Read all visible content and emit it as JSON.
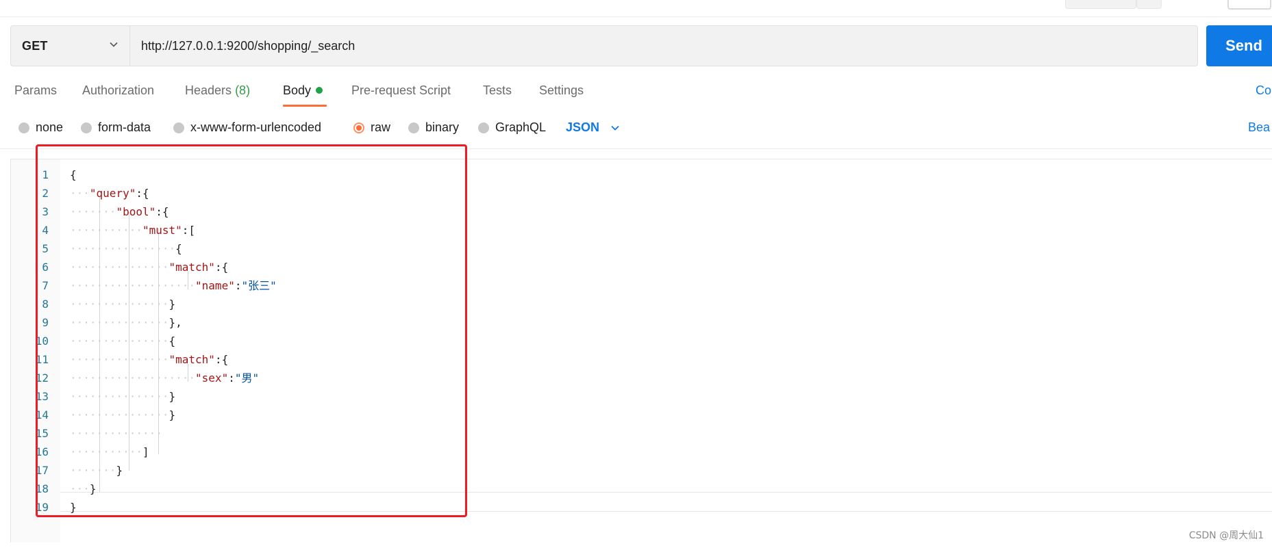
{
  "request": {
    "method": "GET",
    "url": "http://127.0.0.1:9200/shopping/_search",
    "send_label": "Send"
  },
  "tabs": [
    {
      "label": "Params"
    },
    {
      "label": "Authorization"
    },
    {
      "label": "Headers",
      "count": "(8)"
    },
    {
      "label": "Body"
    },
    {
      "label": "Pre-request Script"
    },
    {
      "label": "Tests"
    },
    {
      "label": "Settings"
    }
  ],
  "tabs_right_link": "Co",
  "body_types": [
    {
      "label": "none"
    },
    {
      "label": "form-data"
    },
    {
      "label": "x-www-form-urlencoded"
    },
    {
      "label": "raw"
    },
    {
      "label": "binary"
    },
    {
      "label": "GraphQL"
    }
  ],
  "selected_body_type": "raw",
  "language": "JSON",
  "beautify_label": "Bea",
  "editor": {
    "lines": [
      {
        "n": "1",
        "indent": "",
        "code": [
          {
            "t": "{",
            "c": "p"
          }
        ]
      },
      {
        "n": "2",
        "indent": "···",
        "code": [
          {
            "t": "\"query\"",
            "c": "k"
          },
          {
            "t": ":{",
            "c": "p"
          }
        ]
      },
      {
        "n": "3",
        "indent": "·······",
        "code": [
          {
            "t": "\"bool\"",
            "c": "k"
          },
          {
            "t": ":{",
            "c": "p"
          }
        ]
      },
      {
        "n": "4",
        "indent": "···········",
        "code": [
          {
            "t": "\"must\"",
            "c": "k"
          },
          {
            "t": ":[",
            "c": "p"
          }
        ]
      },
      {
        "n": "5",
        "indent": "················",
        "code": [
          {
            "t": "{",
            "c": "p"
          }
        ]
      },
      {
        "n": "6",
        "indent": "···············",
        "code": [
          {
            "t": "\"match\"",
            "c": "k"
          },
          {
            "t": ":{",
            "c": "p"
          }
        ]
      },
      {
        "n": "7",
        "indent": "···················",
        "code": [
          {
            "t": "\"name\"",
            "c": "k"
          },
          {
            "t": ":",
            "c": "p"
          },
          {
            "t": "\"张三\"",
            "c": "s"
          }
        ]
      },
      {
        "n": "8",
        "indent": "···············",
        "code": [
          {
            "t": "}",
            "c": "p"
          }
        ]
      },
      {
        "n": "9",
        "indent": "···············",
        "code": [
          {
            "t": "},",
            "c": "p"
          }
        ]
      },
      {
        "n": "10",
        "indent": "···············",
        "code": [
          {
            "t": "{",
            "c": "p"
          }
        ]
      },
      {
        "n": "11",
        "indent": "···············",
        "code": [
          {
            "t": "\"match\"",
            "c": "k"
          },
          {
            "t": ":{",
            "c": "p"
          }
        ]
      },
      {
        "n": "12",
        "indent": "···················",
        "code": [
          {
            "t": "\"sex\"",
            "c": "k"
          },
          {
            "t": ":",
            "c": "p"
          },
          {
            "t": "\"男\"",
            "c": "s"
          }
        ]
      },
      {
        "n": "13",
        "indent": "···············",
        "code": [
          {
            "t": "}",
            "c": "p"
          }
        ]
      },
      {
        "n": "14",
        "indent": "···············",
        "code": [
          {
            "t": "}",
            "c": "p"
          }
        ]
      },
      {
        "n": "15",
        "indent": "··············",
        "code": []
      },
      {
        "n": "16",
        "indent": "···········",
        "code": [
          {
            "t": "]",
            "c": "p"
          }
        ]
      },
      {
        "n": "17",
        "indent": "·······",
        "code": [
          {
            "t": "}",
            "c": "p"
          }
        ]
      },
      {
        "n": "18",
        "indent": "···",
        "code": [
          {
            "t": "}",
            "c": "p"
          }
        ]
      },
      {
        "n": "19",
        "indent": "",
        "code": [
          {
            "t": "}",
            "c": "p"
          }
        ]
      }
    ]
  },
  "watermark": "CSDN @周大仙1",
  "colors": {
    "accent_orange": "#ff6c37",
    "primary_blue": "#0f7ae5",
    "annotation_red": "#ed1c24",
    "status_green": "#1ea446"
  }
}
